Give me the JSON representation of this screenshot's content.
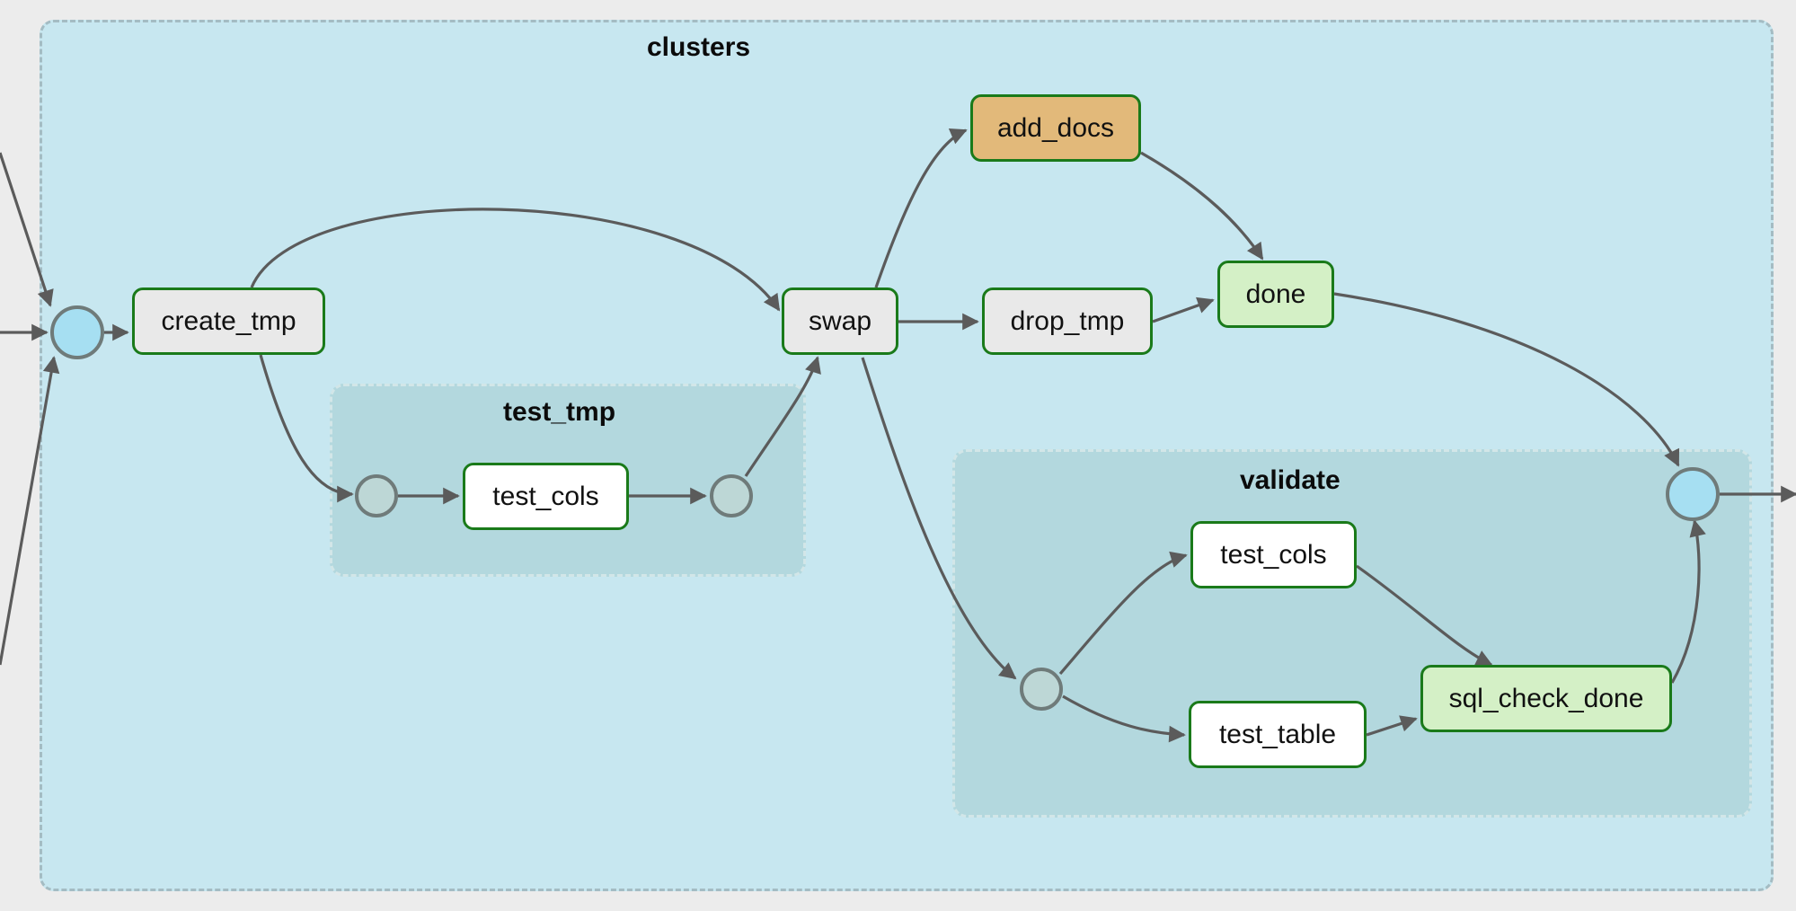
{
  "groups": {
    "clusters": {
      "label": "clusters"
    },
    "test_tmp": {
      "label": "test_tmp"
    },
    "validate": {
      "label": "validate"
    }
  },
  "nodes": {
    "create_tmp": "create_tmp",
    "swap": "swap",
    "add_docs": "add_docs",
    "drop_tmp": "drop_tmp",
    "done": "done",
    "test_cols_1": "test_cols",
    "test_cols_2": "test_cols",
    "test_table": "test_table",
    "sql_check_done": "sql_check_done"
  }
}
